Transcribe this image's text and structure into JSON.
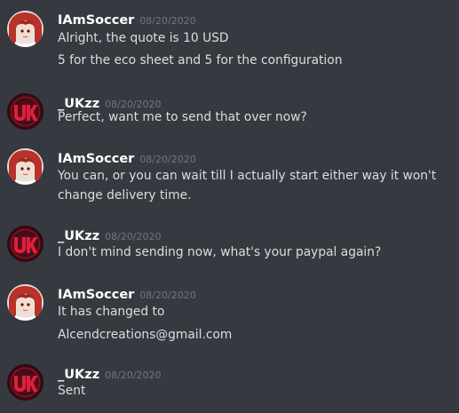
{
  "messages": [
    {
      "author": "IAmSoccer",
      "avatar_icon": "anime-girl-avatar-icon",
      "timestamp": "08/20/2020",
      "lines": [
        "Alright, the quote is 10 USD",
        "5 for the eco sheet and 5 for the configuration"
      ]
    },
    {
      "author": "_UKzz",
      "avatar_icon": "uk-logo-avatar-icon",
      "timestamp": "08/20/2020",
      "lines": [
        "Perfect, want me to send that over now?"
      ]
    },
    {
      "author": "IAmSoccer",
      "avatar_icon": "anime-girl-avatar-icon",
      "timestamp": "08/20/2020",
      "lines": [
        "You can, or you can wait till I actually start either way it won't",
        "change delivery time."
      ]
    },
    {
      "author": "_UKzz",
      "avatar_icon": "uk-logo-avatar-icon",
      "timestamp": "08/20/2020",
      "lines": [
        "I don't mind sending now, what's your paypal again?"
      ]
    },
    {
      "author": "IAmSoccer",
      "avatar_icon": "anime-girl-avatar-icon",
      "timestamp": "08/20/2020",
      "lines": [
        "It has changed to",
        "Alcendcreations@gmail.com"
      ]
    },
    {
      "author": "_UKzz",
      "avatar_icon": "uk-logo-avatar-icon",
      "timestamp": "08/20/2020",
      "lines": [
        "Sent"
      ]
    }
  ],
  "colors": {
    "background": "#36393f",
    "username": "#ffffff",
    "timestamp": "#72767d",
    "message_text": "#dcddde",
    "uk_avatar_red": "#c8102e",
    "anime_avatar_hair": "#c0392b"
  }
}
